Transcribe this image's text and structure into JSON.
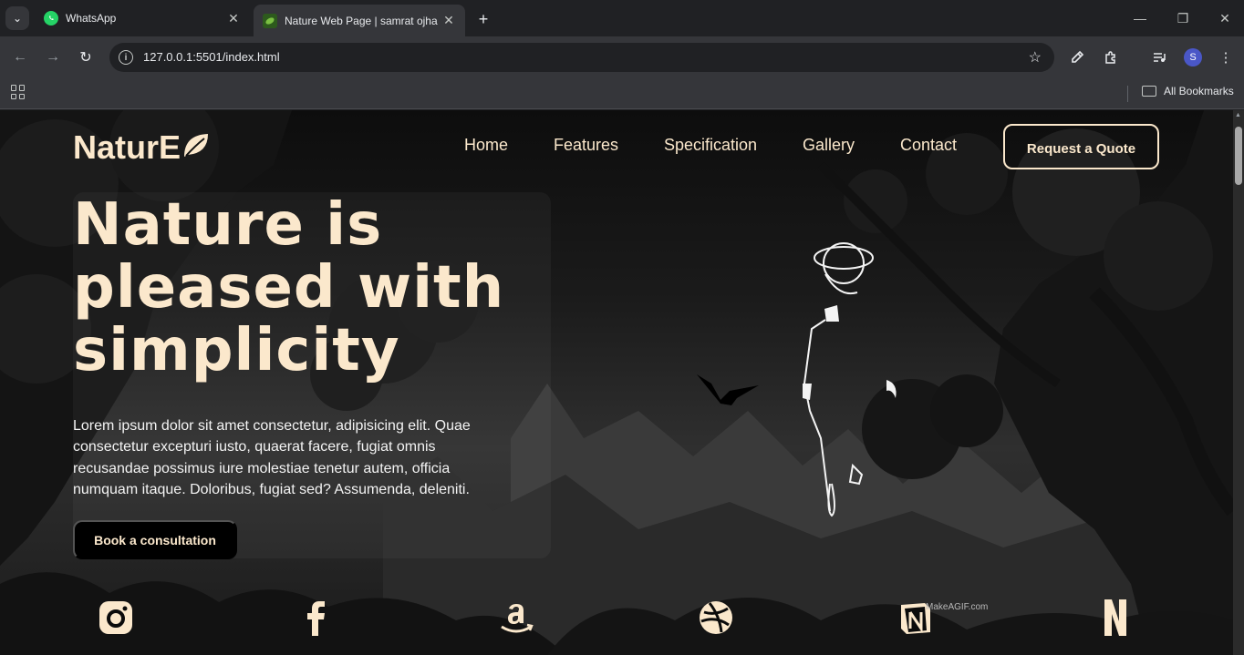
{
  "browser": {
    "tabs": [
      {
        "title": "WhatsApp",
        "favicon": "whatsapp-icon",
        "active": false
      },
      {
        "title": "Nature Web Page | samrat ojha",
        "favicon": "nature-favicon",
        "active": true
      }
    ],
    "url": "127.0.0.1:5501/index.html",
    "bookmarks_label": "All Bookmarks",
    "profile_initial": "S"
  },
  "site": {
    "logo_text": "NaturE",
    "nav": [
      "Home",
      "Features",
      "Specification",
      "Gallery",
      "Contact"
    ],
    "quote_button": "Request a Quote",
    "headline_lines": [
      "Nature is",
      "pleased with",
      "simplicity"
    ],
    "lede": "Lorem ipsum dolor sit amet consectetur, adipisicing elit. Quae consectetur excepturi iusto, quaerat facere, fugiat omnis recusandae possimus iure molestiae tenetur autem, officia numquam itaque. Doloribus, fugiat sed? Assumenda, deleniti.",
    "cta_button": "Book a consultation",
    "brands": [
      "instagram-icon",
      "facebook-icon",
      "amazon-icon",
      "dribbble-icon",
      "notion-icon",
      "netflix-icon"
    ],
    "watermark": "MakeAGIF.com"
  },
  "colors": {
    "accent": "#fbe8cc",
    "chrome_dark": "#202124",
    "chrome_mid": "#35363a"
  }
}
